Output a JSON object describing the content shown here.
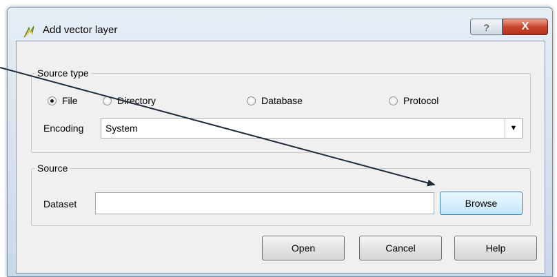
{
  "window": {
    "title": "Add vector layer",
    "help_label": "?",
    "close_label": "X"
  },
  "source_type": {
    "legend": "Source type",
    "options": [
      {
        "label": "File",
        "checked": true
      },
      {
        "label": "Directory",
        "checked": false
      },
      {
        "label": "Database",
        "checked": false
      },
      {
        "label": "Protocol",
        "checked": false
      }
    ],
    "encoding_label": "Encoding",
    "encoding_value": "System"
  },
  "source": {
    "legend": "Source",
    "dataset_label": "Dataset",
    "dataset_value": "",
    "browse_label": "Browse"
  },
  "buttons": {
    "open": "Open",
    "cancel": "Cancel",
    "help": "Help"
  },
  "icons": {
    "app": "qgis-logo-icon",
    "dropdown": "dropdown-arrow-icon",
    "annotation": "annotation-arrow-icon"
  },
  "colors": {
    "close_button": "#c9462d",
    "title_bar": "#dbe6f1",
    "dialog_background": "#f0f0f0"
  }
}
